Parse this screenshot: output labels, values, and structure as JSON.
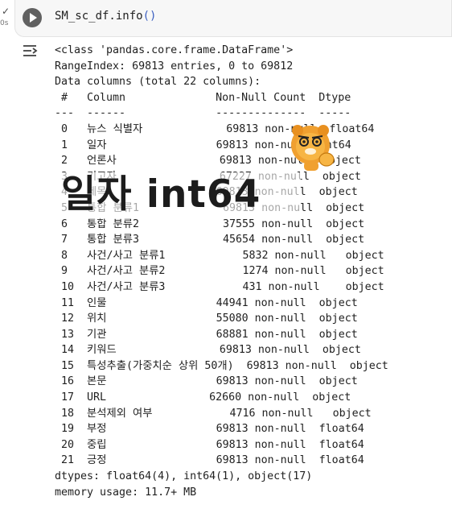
{
  "cell": {
    "code": "SM_sc_df.info",
    "code_parens": "()",
    "exec_time": "0s",
    "run_icon": "play-icon",
    "status_icon": "check-icon",
    "output_icon": "output-menu-icon"
  },
  "output": {
    "lines": [
      "<class 'pandas.core.frame.DataFrame'>",
      "RangeIndex: 69813 entries, 0 to 69812",
      "Data columns (total 22 columns):",
      " #   Column              Non-Null Count  Dtype  ",
      "---  ------              --------------  -----  ",
      " 0   뉴스 식별자             69813 non-null  float64",
      " 1   일자                 69813 non-null  int64  ",
      " 2   언론사                69813 non-null  object ",
      " 3   기고자                67227 non-null  object ",
      " 4   제목                 69813 non-null  object ",
      " 5   통합 분류1             69813 non-null  object ",
      " 6   통합 분류2             37555 non-null  object ",
      " 7   통합 분류3             45654 non-null  object ",
      " 8   사건/사고 분류1            5832 non-null   object ",
      " 9   사건/사고 분류2            1274 non-null   object ",
      " 10  사건/사고 분류3            431 non-null    object ",
      " 11  인물                 44941 non-null  object ",
      " 12  위치                 55080 non-null  object ",
      " 13  기관                 68881 non-null  object ",
      " 14  키워드                69813 non-null  object ",
      " 15  특성추출(가중치순 상위 50개)  69813 non-null  object ",
      " 16  본문                 69813 non-null  object ",
      " 17  URL                62660 non-null  object ",
      " 18  분석제외 여부            4716 non-null   object ",
      " 19  부정                 69813 non-null  float64",
      " 20  중립                 69813 non-null  float64",
      " 21  긍정                 69813 non-null  float64",
      "dtypes: float64(4), int64(1), object(17)",
      "memory usage: 11.7+ MB"
    ]
  },
  "overlay": {
    "caption": "일자 int64",
    "sticker_icon": "thinking-lion-sticker-icon"
  }
}
